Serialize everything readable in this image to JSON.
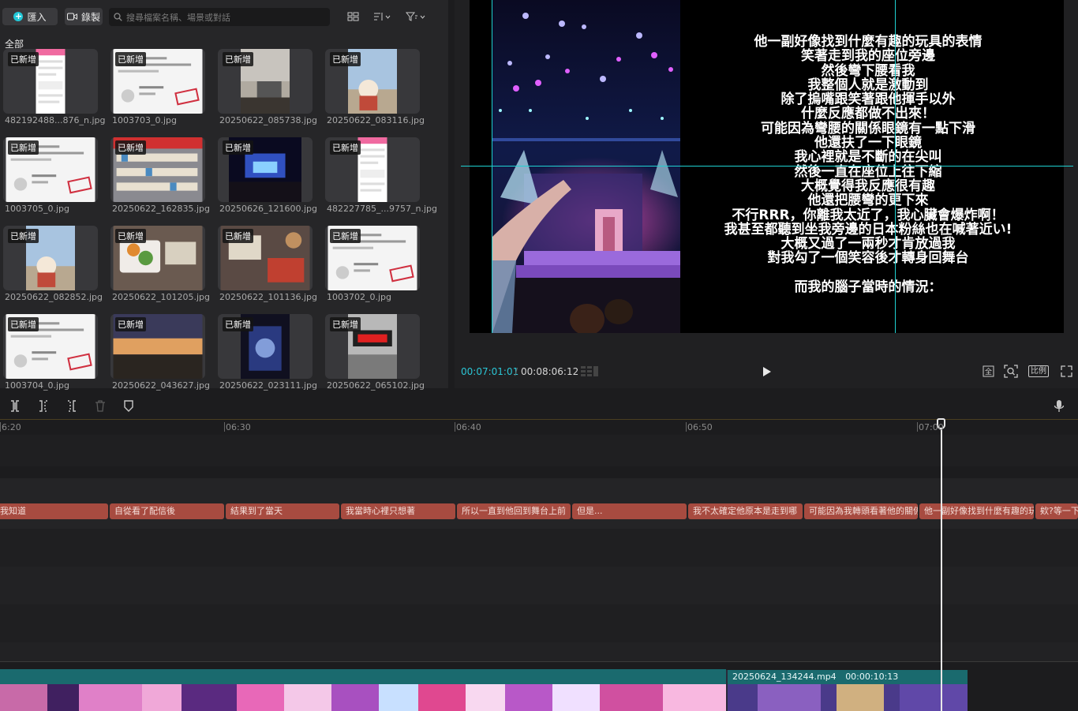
{
  "media": {
    "import_label": "匯入",
    "record_label": "錄製",
    "search_placeholder": "搜尋檔案名稱、場景或對話",
    "all_label": "全部",
    "added_badge": "已新增",
    "files": [
      {
        "name": "482192488...876_n.jpg",
        "kind": "pink-screenshot"
      },
      {
        "name": "1003703_0.jpg",
        "kind": "ticket"
      },
      {
        "name": "20250622_085738.jpg",
        "kind": "room"
      },
      {
        "name": "20250622_083116.jpg",
        "kind": "plush-sky"
      },
      {
        "name": "1003705_0.jpg",
        "kind": "ticket"
      },
      {
        "name": "20250622_162835.jpg",
        "kind": "shelves"
      },
      {
        "name": "20250626_121600.jpg",
        "kind": "stage"
      },
      {
        "name": "482227785_...9757_n.jpg",
        "kind": "pink-screenshot"
      },
      {
        "name": "20250622_082852.jpg",
        "kind": "plush-sky"
      },
      {
        "name": "20250622_101205.jpg",
        "kind": "food"
      },
      {
        "name": "20250622_101136.jpg",
        "kind": "food2"
      },
      {
        "name": "1003702_0.jpg",
        "kind": "ticket"
      },
      {
        "name": "1003704_0.jpg",
        "kind": "ticket"
      },
      {
        "name": "20250622_043627.jpg",
        "kind": "sunset"
      },
      {
        "name": "20250622_023111.jpg",
        "kind": "screen-dark"
      },
      {
        "name": "20250622_065102.jpg",
        "kind": "clock"
      }
    ]
  },
  "preview": {
    "subtitle_lines": [
      "他一副好像找到什麼有趣的玩具的表情",
      "笑著走到我的座位旁邊",
      "然後彎下腰看我",
      "我整個人就是激動到",
      "除了摀嘴跟笑著跟他揮手以外",
      "什麼反應都做不出來！",
      "可能因為彎腰的關係眼鏡有一點下滑",
      "他還扶了一下眼鏡",
      "我心裡就是不斷的在尖叫",
      "然後一直在座位上往下縮",
      "大概覺得我反應很有趣",
      "他還把腰彎的更下來",
      "不行RRR，你離我太近了，我心臟會爆炸啊！",
      "我甚至都聽到坐我旁邊的日本粉絲也在喊著近い!",
      "大概又過了一兩秒才肯放過我",
      "對我勾了一個笑容後才轉身回舞台",
      "",
      "而我的腦子當時的情況："
    ],
    "time_current": "00:07:01:01",
    "time_total": "00:08:06:12",
    "ratio_label": "比例"
  },
  "timeline": {
    "ruler_labels": [
      "6:20",
      "06:30",
      "06:40",
      "06:50",
      "07:00"
    ],
    "subtitle_clips": [
      "我知道",
      "自從看了配信後",
      "結果到了當天",
      "我當時心裡只想著",
      "所以一直到他回到舞台上前",
      "但是...",
      "我不太確定他原本是走到哪",
      "可能因為我轉頭看著他的關係",
      "他一副好像找到什麼有趣的玩具",
      "欸?等一下"
    ],
    "video_clip_name": "20250624_134244.mp4",
    "video_clip_duration": "00:00:10:13"
  },
  "colors": {
    "accent": "#22c8d8",
    "subtitle_clip": "#a74b40",
    "video_clip_header": "#1a6a6e"
  }
}
